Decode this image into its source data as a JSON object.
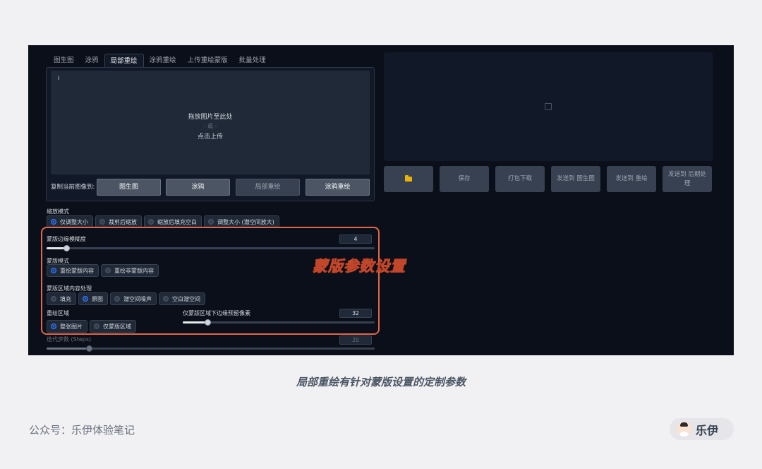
{
  "tabs": [
    "图生图",
    "涂鸦",
    "局部重绘",
    "涂鸦重绘",
    "上传重绘蒙版",
    "批量处理"
  ],
  "active_tab": "局部重绘",
  "image_panel": {
    "info_icon": "i",
    "drop_line1": "拖放图片至此处",
    "drop_or": "- 或 -",
    "drop_line2": "点击上传"
  },
  "copy_row": {
    "label": "复制当前图像到:",
    "buttons": [
      "图生图",
      "涂鸦",
      "局部重绘",
      "涂鸦重绘"
    ]
  },
  "resize_mode": {
    "label": "缩放模式",
    "options": [
      "仅调整大小",
      "裁剪后缩放",
      "缩放后填充空白",
      "调整大小 (潜空间放大)"
    ],
    "selected": "仅调整大小"
  },
  "mask_blur": {
    "label": "蒙版边缘模糊度",
    "value": "4",
    "fraction": 0.06
  },
  "mask_mode": {
    "label": "蒙版模式",
    "options": [
      "重绘蒙版内容",
      "重绘非蒙版内容"
    ],
    "selected": "重绘蒙版内容"
  },
  "masked_content": {
    "label": "蒙版区域内容处理",
    "options": [
      "填充",
      "原图",
      "潜空间噪声",
      "空白潜空间"
    ],
    "selected": "原图"
  },
  "inpaint_area": {
    "label": "重绘区域",
    "options": [
      "整张图片",
      "仅蒙版区域"
    ],
    "selected": "整张图片"
  },
  "padding": {
    "label": "仅蒙版区域下边缘预留像素",
    "value": "32",
    "fraction": 0.13
  },
  "steps": {
    "label": "迭代步数 (Steps)",
    "value": "20",
    "fraction": 0.13
  },
  "callout": "蒙版参数设置",
  "right_panel": {
    "icons": [
      "image-placeholder-icon",
      "folder-icon"
    ],
    "buttons": [
      "保存",
      "打包下载",
      "发送到 图生图",
      "发送到 重绘",
      "发送到 后期处理"
    ]
  },
  "caption": "局部重绘有针对蒙版设置的定制参数",
  "footer": {
    "account": "公众号：乐伊体验笔记",
    "author": "乐伊"
  },
  "colors": {
    "highlight": "#e2674a",
    "callout": "#f5a25f",
    "radio_on": "#3b82f6"
  }
}
